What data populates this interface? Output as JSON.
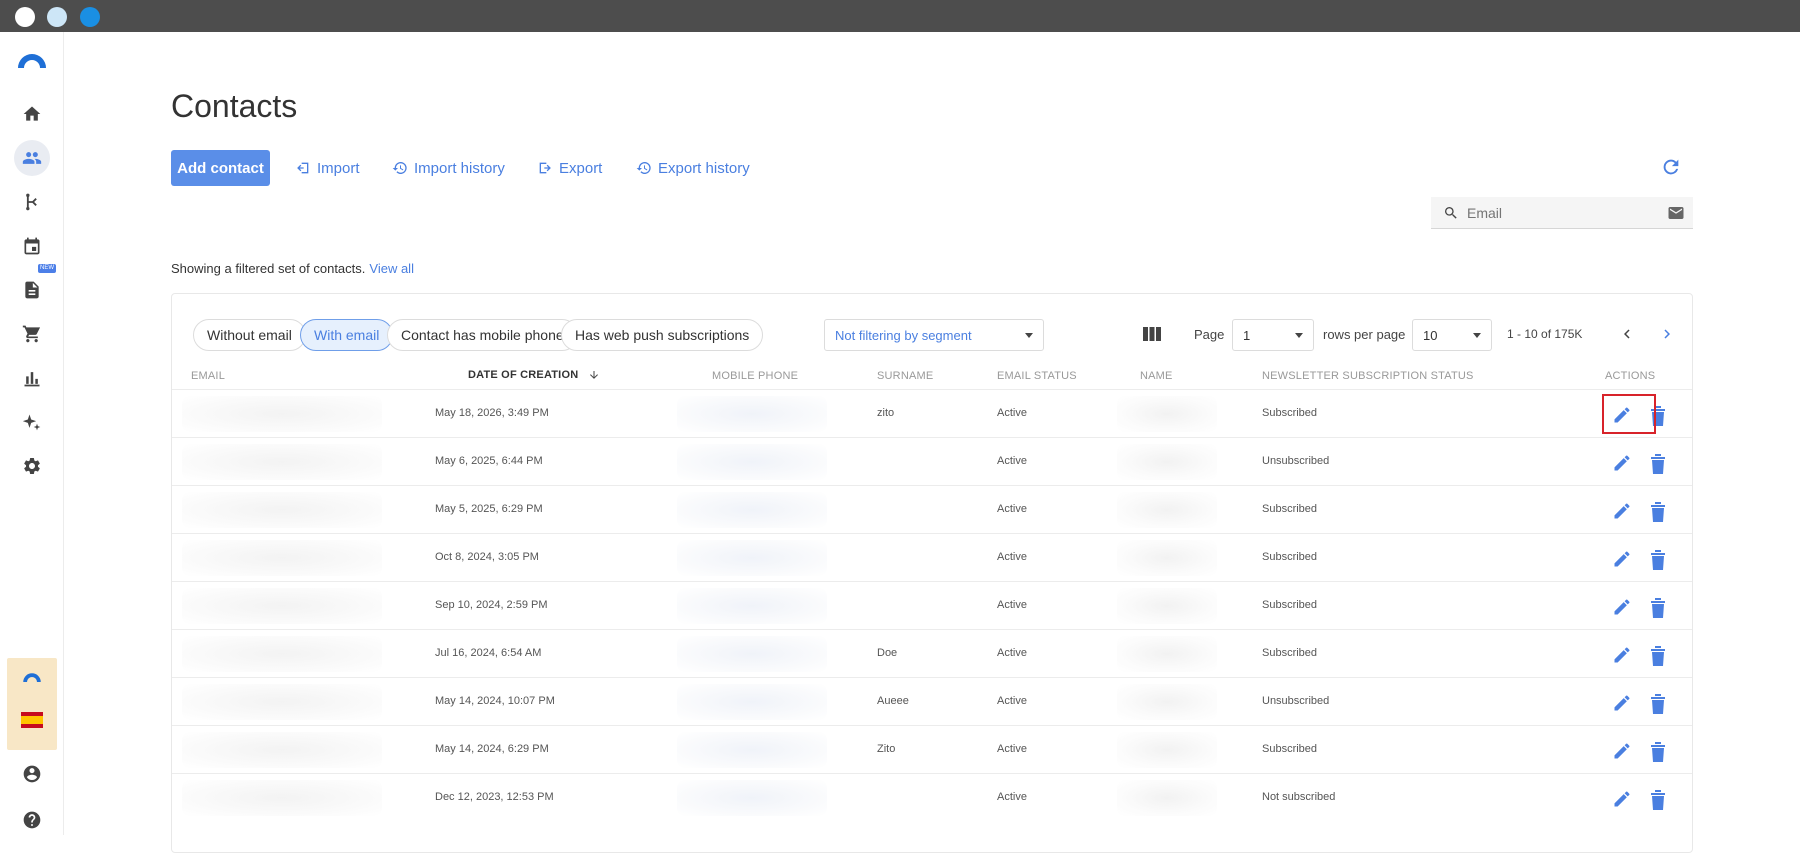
{
  "colors": {
    "accent": "#4a7fe0",
    "primary_button": "#5a8ee8",
    "highlight": "#d8232a",
    "titlebar": "#4d4d4d"
  },
  "sidebar": {
    "items": [
      {
        "icon": "home-icon"
      },
      {
        "icon": "contacts-icon",
        "active": true
      },
      {
        "icon": "flow-icon"
      },
      {
        "icon": "calendar-icon",
        "badge": "NEW"
      },
      {
        "icon": "document-icon"
      },
      {
        "icon": "cart-icon"
      },
      {
        "icon": "chart-icon"
      },
      {
        "icon": "sparkle-icon"
      },
      {
        "icon": "gear-icon"
      }
    ],
    "bottom": [
      {
        "icon": "account-icon"
      },
      {
        "icon": "help-icon"
      }
    ]
  },
  "page": {
    "title": "Contacts"
  },
  "toolbar": {
    "add_label": "Add contact",
    "import_label": "Import",
    "import_history_label": "Import history",
    "export_label": "Export",
    "export_history_label": "Export history"
  },
  "search": {
    "placeholder": "Email"
  },
  "filter_note": {
    "text": "Showing a filtered set of contacts.",
    "link": "View all"
  },
  "filters": {
    "chips": [
      {
        "label": "Without email",
        "active": false
      },
      {
        "label": "With email",
        "active": true
      },
      {
        "label": "Contact has mobile phone",
        "active": false
      },
      {
        "label": "Has web push subscriptions",
        "active": false
      }
    ],
    "segment": "Not filtering by segment"
  },
  "pagination": {
    "page_label": "Page",
    "page_value": "1",
    "rows_label": "rows per page",
    "rows_value": "10",
    "range": "1 - 10 of 175K"
  },
  "table": {
    "headers": {
      "email": "EMAIL",
      "date": "DATE OF CREATION",
      "phone": "MOBILE PHONE",
      "surname": "SURNAME",
      "email_status": "EMAIL STATUS",
      "name": "NAME",
      "newsletter": "NEWSLETTER SUBSCRIPTION STATUS",
      "actions": "ACTIONS"
    },
    "rows": [
      {
        "date": "May 18, 2026, 3:49 PM",
        "surname": "zito",
        "status": "Active",
        "newsletter": "Subscribed"
      },
      {
        "date": "May 6, 2025, 6:44 PM",
        "surname": "",
        "status": "Active",
        "newsletter": "Unsubscribed"
      },
      {
        "date": "May 5, 2025, 6:29 PM",
        "surname": "",
        "status": "Active",
        "newsletter": "Subscribed"
      },
      {
        "date": "Oct 8, 2024, 3:05 PM",
        "surname": "",
        "status": "Active",
        "newsletter": "Subscribed"
      },
      {
        "date": "Sep 10, 2024, 2:59 PM",
        "surname": "",
        "status": "Active",
        "newsletter": "Subscribed"
      },
      {
        "date": "Jul 16, 2024, 6:54 AM",
        "surname": "Doe",
        "status": "Active",
        "newsletter": "Subscribed"
      },
      {
        "date": "May 14, 2024, 10:07 PM",
        "surname": "Aueee",
        "status": "Active",
        "newsletter": "Unsubscribed"
      },
      {
        "date": "May 14, 2024, 6:29 PM",
        "surname": "Zito",
        "status": "Active",
        "newsletter": "Subscribed"
      },
      {
        "date": "Dec 12, 2023, 12:53 PM",
        "surname": "",
        "status": "Active",
        "newsletter": "Not subscribed"
      }
    ]
  }
}
